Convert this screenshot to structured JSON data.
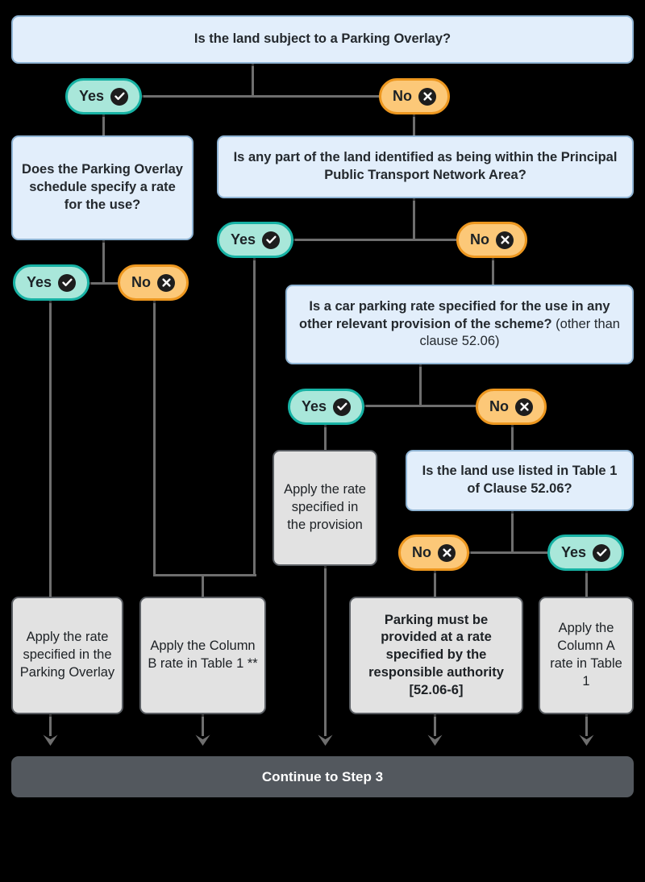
{
  "diagram": {
    "title": "Car parking rate decision flowchart (Step 2)",
    "colors": {
      "background": "#000000",
      "question_fill": "#e2eefb",
      "question_border": "#8fb4d4",
      "result_fill": "#e2e2e2",
      "result_border": "#5a5e63",
      "yes_fill": "#a9e7da",
      "yes_border": "#17b2a4",
      "no_fill": "#fcc878",
      "no_border": "#ed971f",
      "connector": "#6e6e6e",
      "footer_fill": "#53585e",
      "footer_text": "#ffffff"
    }
  },
  "questions": {
    "q1": "Is the land subject to a Parking Overlay?",
    "q2": "Does the Parking Overlay schedule specify a rate for the use?",
    "q3": "Is any part of the land identified as being within the Principal Public Transport Network Area?",
    "q4_bold": "Is a car parking rate specified for the use in any other relevant provision of the scheme?",
    "q4_soft": "(other than clause 52.06)",
    "q5": "Is the land use listed in Table 1 of Clause 52.06?"
  },
  "pills": {
    "q1_yes": "Yes",
    "q1_no": "No",
    "q2_yes": "Yes",
    "q2_no": "No",
    "q3_yes": "Yes",
    "q3_no": "No",
    "q4_yes": "Yes",
    "q4_no": "No",
    "q5_no": "No",
    "q5_yes": "Yes"
  },
  "outcomes": {
    "o1": "Apply the rate specified in the Parking Overlay",
    "o2": "Apply the Column B rate in Table 1 **",
    "o3": "Apply the rate specified in the provision",
    "o4": "Parking must be provided at a rate specified by the responsible authority [52.06-6]",
    "o5": "Apply the Column A rate in Table 1"
  },
  "footer": {
    "label": "Continue to Step 3"
  },
  "icons": {
    "yes": "check-circle-icon",
    "no": "cross-circle-icon",
    "arrow": "arrow-down-icon"
  }
}
